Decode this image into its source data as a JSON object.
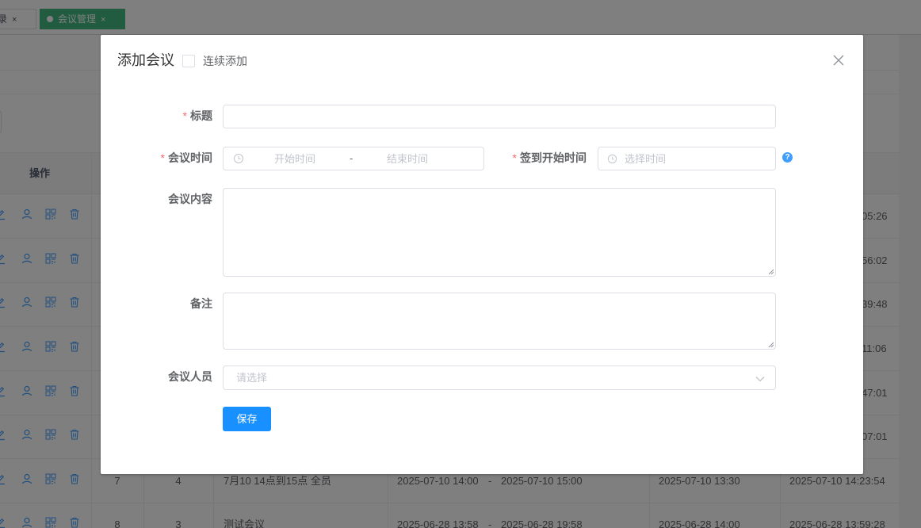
{
  "tabs": [
    {
      "label": "录",
      "close": "×"
    },
    {
      "label": "会议管理",
      "close": "×"
    }
  ],
  "table": {
    "ops_header": "操作",
    "rows": [
      {
        "tail": "05:26"
      },
      {
        "tail": "56:02"
      },
      {
        "tail": "39:48"
      },
      {
        "tail": "11:06"
      },
      {
        "tail": "47:01"
      },
      {
        "tail": "07:01"
      },
      {
        "index": "7",
        "count": "4",
        "title": "7月10 14点到15点 全员",
        "start": "2025-07-10 14:00",
        "sep": "-",
        "end": "2025-07-10 15:00",
        "signin": "2025-07-10 13:30",
        "created": "2025-07-10 14:23:54"
      },
      {
        "index": "8",
        "count": "3",
        "title": "测试会议",
        "start": "2025-06-28 13:58",
        "sep": "-",
        "end": "2025-06-28 19:58",
        "signin": "2025-06-28 14:00",
        "created": "2025-06-28 13:59:28"
      }
    ]
  },
  "dialog": {
    "title": "添加会议",
    "continuous_add_label": "连续添加",
    "continuous_add_checked": false,
    "form": {
      "title_label": "标题",
      "title_value": "",
      "meeting_time_label": "会议时间",
      "start_placeholder": "开始时间",
      "range_separator": "-",
      "end_placeholder": "结束时间",
      "signin_label": "签到开始时间",
      "signin_placeholder": "选择时间",
      "content_label": "会议内容",
      "content_value": "",
      "remark_label": "备注",
      "remark_value": "",
      "members_label": "会议人员",
      "members_placeholder": "请选择",
      "required_mark": "*",
      "help_icon": "?"
    },
    "save_label": "保存"
  },
  "colors": {
    "accent_tag": "#42b983",
    "primary": "#1890ff",
    "required": "#f56c6c",
    "icon_blue": "#409eff"
  },
  "icons": [
    "close-icon",
    "clock-icon",
    "chevron-down-icon",
    "question-icon",
    "edit-icon",
    "user-icon",
    "qrcode-icon",
    "delete-icon"
  ]
}
